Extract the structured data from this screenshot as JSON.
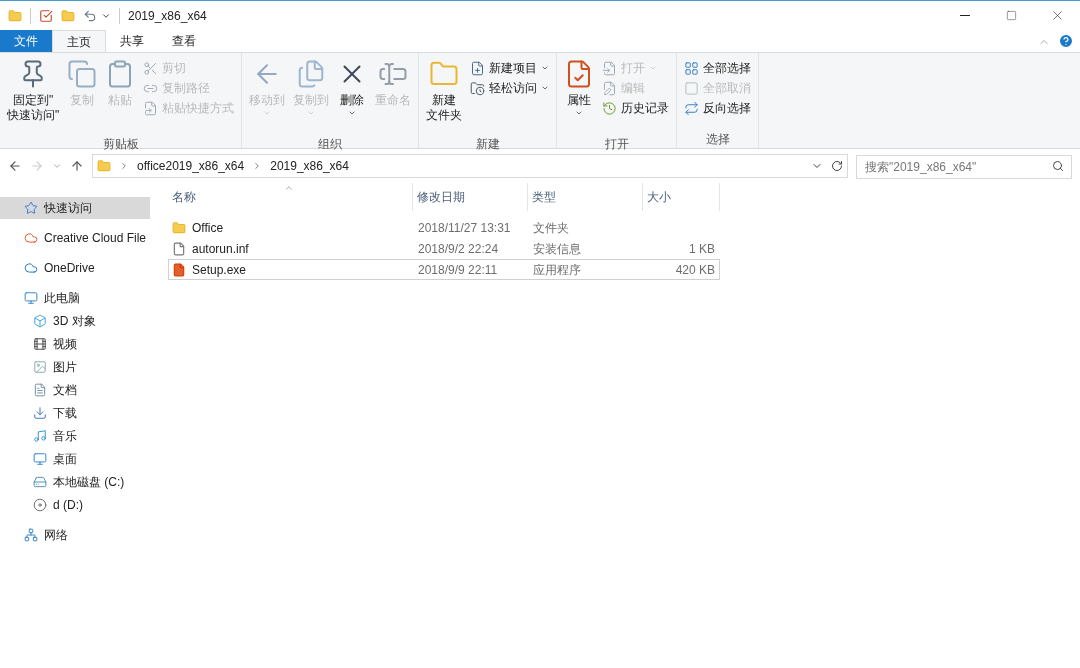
{
  "window": {
    "title": "2019_x86_x64"
  },
  "ribbon": {
    "tabs": [
      {
        "label": "文件",
        "kind": "file",
        "selected": false
      },
      {
        "label": "主页",
        "kind": "tab",
        "selected": true
      },
      {
        "label": "共享",
        "kind": "tab",
        "selected": false
      },
      {
        "label": "查看",
        "kind": "tab",
        "selected": false
      }
    ],
    "groups": [
      {
        "label": "剪贴板",
        "large": [
          {
            "lines": [
              "固定到\"",
              "快速访问\""
            ],
            "disabled": false,
            "dropdown": false
          },
          {
            "lines": [
              "复制"
            ],
            "disabled": true,
            "dropdown": false
          },
          {
            "lines": [
              "粘贴"
            ],
            "disabled": true,
            "dropdown": false
          }
        ],
        "small": [
          {
            "label": "剪切",
            "disabled": true,
            "dropdown": false
          },
          {
            "label": "复制路径",
            "disabled": true,
            "dropdown": false
          },
          {
            "label": "粘贴快捷方式",
            "disabled": true,
            "dropdown": false
          }
        ]
      },
      {
        "label": "组织",
        "large": [
          {
            "lines": [
              "移动到"
            ],
            "disabled": true,
            "dropdown": true
          },
          {
            "lines": [
              "复制到"
            ],
            "disabled": true,
            "dropdown": true
          },
          {
            "lines": [
              "删除"
            ],
            "disabled": false,
            "dropdown": true
          },
          {
            "lines": [
              "重命名"
            ],
            "disabled": true,
            "dropdown": false
          }
        ]
      },
      {
        "label": "新建",
        "large": [
          {
            "lines": [
              "新建",
              "文件夹"
            ],
            "disabled": false,
            "dropdown": false
          }
        ],
        "small": [
          {
            "label": "新建项目",
            "disabled": false,
            "dropdown": true
          },
          {
            "label": "轻松访问",
            "disabled": false,
            "dropdown": true
          }
        ]
      },
      {
        "label": "打开",
        "large": [
          {
            "lines": [
              "属性"
            ],
            "disabled": false,
            "dropdown": true
          }
        ],
        "small": [
          {
            "label": "打开",
            "disabled": true,
            "dropdown": true
          },
          {
            "label": "编辑",
            "disabled": true,
            "dropdown": false
          },
          {
            "label": "历史记录",
            "disabled": false,
            "dropdown": false
          }
        ]
      },
      {
        "label": "选择",
        "small": [
          {
            "label": "全部选择",
            "disabled": false,
            "dropdown": false
          },
          {
            "label": "全部取消",
            "disabled": true,
            "dropdown": false
          },
          {
            "label": "反向选择",
            "disabled": false,
            "dropdown": false
          }
        ]
      }
    ]
  },
  "address": {
    "segments": [
      "office2019_x86_x64",
      "2019_x86_x64"
    ]
  },
  "search": {
    "placeholder": "搜索\"2019_x86_x64\""
  },
  "sidebar": {
    "items": [
      {
        "label": "快速访问",
        "selected": true
      },
      {
        "label": "Creative Cloud File",
        "selected": false
      },
      {
        "label": "OneDrive",
        "selected": false
      },
      {
        "label": "此电脑",
        "selected": false,
        "children": [
          {
            "label": "3D 对象",
            "selected": false
          },
          {
            "label": "视频",
            "selected": false
          },
          {
            "label": "图片",
            "selected": false
          },
          {
            "label": "文档",
            "selected": false
          },
          {
            "label": "下载",
            "selected": false
          },
          {
            "label": "音乐",
            "selected": false
          },
          {
            "label": "桌面",
            "selected": false
          },
          {
            "label": "本地磁盘 (C:)",
            "selected": false
          },
          {
            "label": "d (D:)",
            "selected": false
          }
        ]
      },
      {
        "label": "网络",
        "selected": false
      }
    ]
  },
  "table": {
    "columns": [
      "名称",
      "修改日期",
      "类型",
      "大小"
    ],
    "rows": [
      {
        "kind": "folder",
        "name": "Office",
        "date": "2018/11/27 13:31",
        "type": "文件夹",
        "selected": false
      },
      {
        "kind": "file",
        "name": "autorun.inf",
        "date": "2018/9/2 22:24",
        "type": "安装信息",
        "size": "1 KB",
        "selected": false
      },
      {
        "kind": "app",
        "name": "Setup.exe",
        "date": "2018/9/9 22:11",
        "type": "应用程序",
        "size": "420 KB",
        "selected": true
      }
    ]
  }
}
